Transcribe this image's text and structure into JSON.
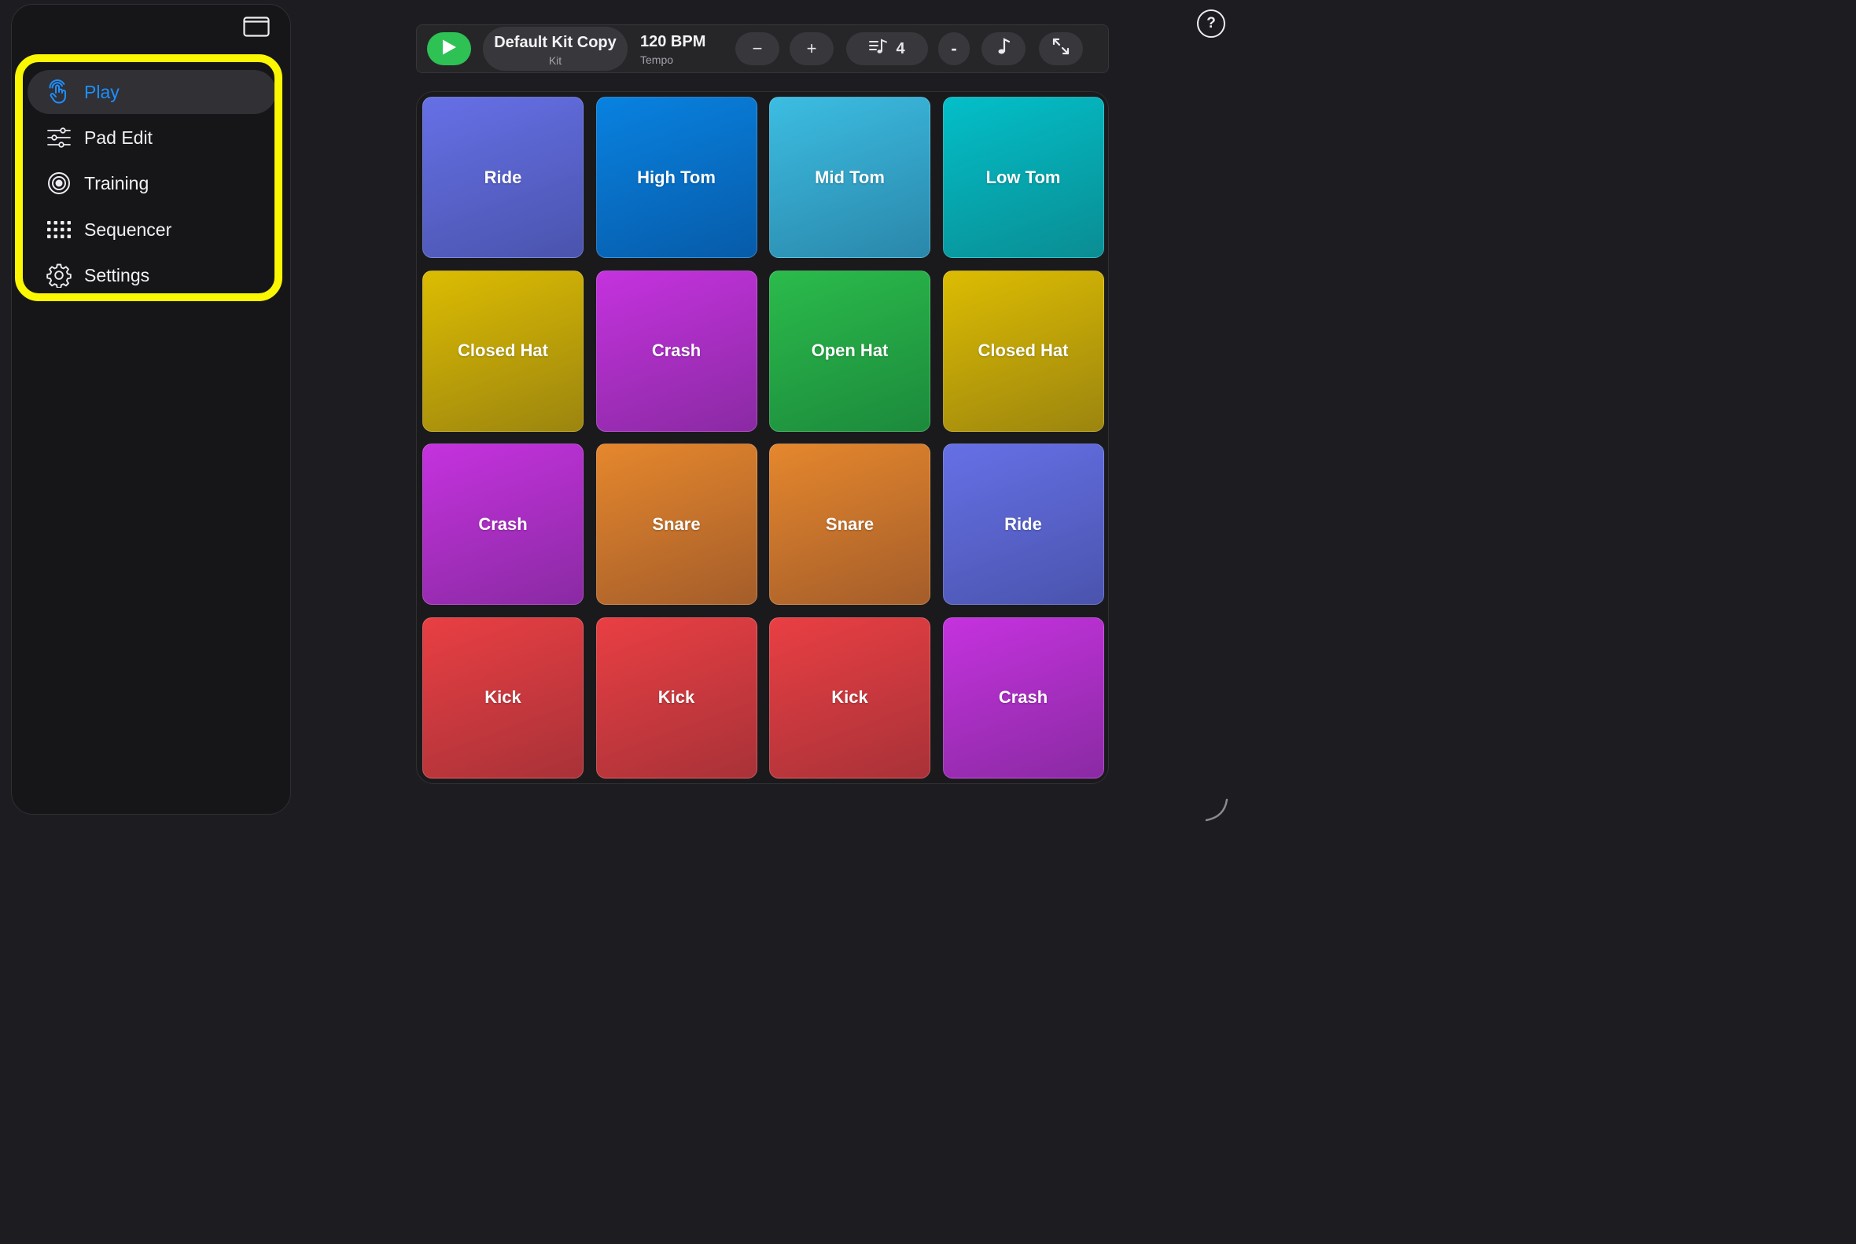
{
  "sidebar": {
    "items": [
      {
        "label": "Play",
        "icon": "hand-tap-icon",
        "active": true
      },
      {
        "label": "Pad Edit",
        "icon": "sliders-icon",
        "active": false
      },
      {
        "label": "Training",
        "icon": "target-icon",
        "active": false
      },
      {
        "label": "Sequencer",
        "icon": "grid-dots-icon",
        "active": false
      },
      {
        "label": "Settings",
        "icon": "gear-icon",
        "active": false
      }
    ]
  },
  "toolbar": {
    "kit_name": "Default Kit Copy",
    "kit_label": "Kit",
    "tempo_value": "120 BPM",
    "tempo_label": "Tempo",
    "decrease_label": "−",
    "increase_label": "+",
    "beats_value": "4",
    "small_minus_label": "-"
  },
  "help_label": "?",
  "colors": {
    "accent_blue": "#1e8fff",
    "play_green": "#2ec254",
    "highlight_yellow": "#fbf602"
  },
  "pads": [
    {
      "label": "Ride",
      "color": "indigo"
    },
    {
      "label": "High Tom",
      "color": "blue"
    },
    {
      "label": "Mid Tom",
      "color": "sky"
    },
    {
      "label": "Low Tom",
      "color": "teal"
    },
    {
      "label": "Closed Hat",
      "color": "yellow"
    },
    {
      "label": "Crash",
      "color": "purple"
    },
    {
      "label": "Open Hat",
      "color": "green"
    },
    {
      "label": "Closed Hat",
      "color": "yellow"
    },
    {
      "label": "Crash",
      "color": "purple"
    },
    {
      "label": "Snare",
      "color": "orange"
    },
    {
      "label": "Snare",
      "color": "orange"
    },
    {
      "label": "Ride",
      "color": "indigo"
    },
    {
      "label": "Kick",
      "color": "red"
    },
    {
      "label": "Kick",
      "color": "red"
    },
    {
      "label": "Kick",
      "color": "red"
    },
    {
      "label": "Crash",
      "color": "purple"
    }
  ]
}
